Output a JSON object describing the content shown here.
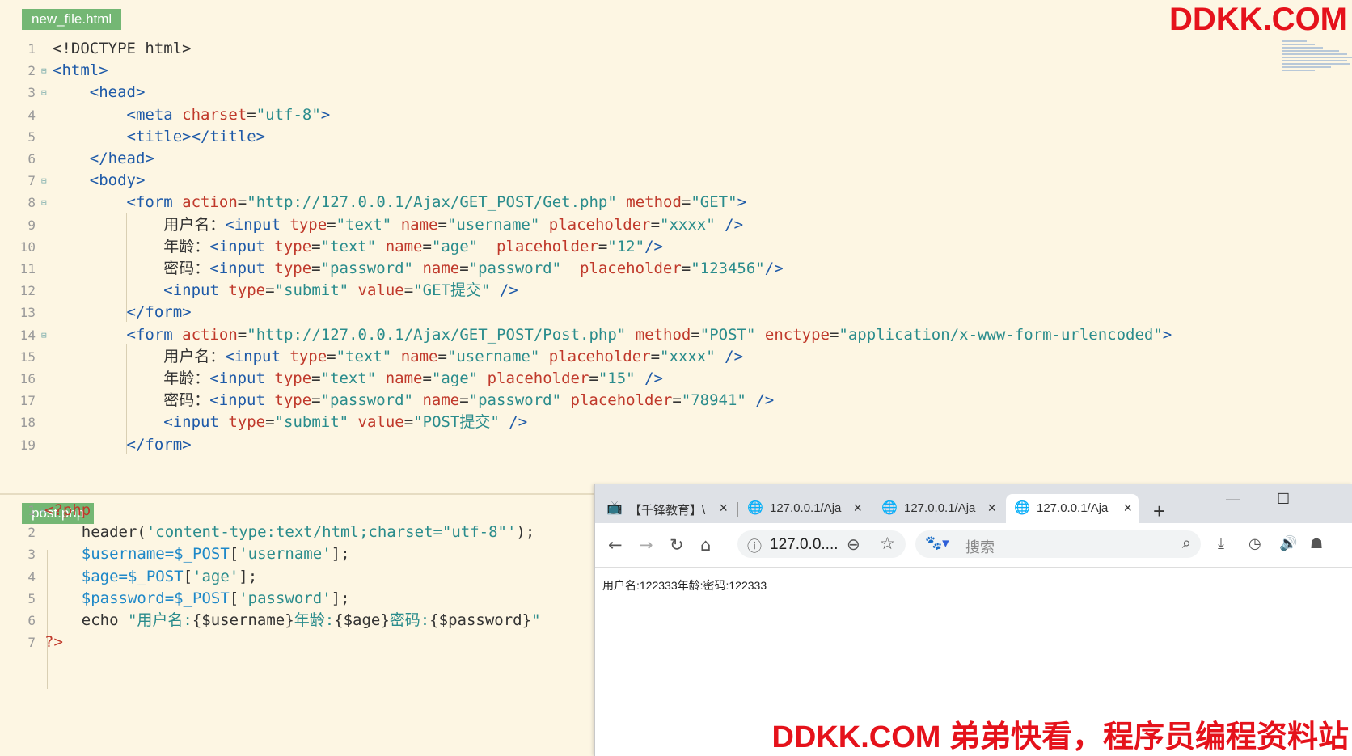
{
  "editor": {
    "top_tab": "new_file.html",
    "bottom_tab": "post.php",
    "html_lines": [
      {
        "n": "1",
        "fold": "",
        "segs": [
          [
            "t",
            "<!DOCTYPE html>"
          ]
        ]
      },
      {
        "n": "2",
        "fold": "⊟",
        "segs": [
          [
            "tag",
            "<html>"
          ]
        ]
      },
      {
        "n": "3",
        "fold": "⊟",
        "segs": [
          [
            "t",
            "    "
          ],
          [
            "tag",
            "<head>"
          ]
        ]
      },
      {
        "n": "4",
        "fold": "",
        "segs": [
          [
            "t",
            "        "
          ],
          [
            "tag",
            "<meta "
          ],
          [
            "attr",
            "charset"
          ],
          [
            "t",
            "="
          ],
          [
            "val",
            "\"utf-8\""
          ],
          [
            "tag",
            ">"
          ]
        ]
      },
      {
        "n": "5",
        "fold": "",
        "segs": [
          [
            "t",
            "        "
          ],
          [
            "tag",
            "<title></title>"
          ]
        ]
      },
      {
        "n": "6",
        "fold": "",
        "segs": [
          [
            "t",
            "    "
          ],
          [
            "tag",
            "</head>"
          ]
        ]
      },
      {
        "n": "7",
        "fold": "⊟",
        "segs": [
          [
            "t",
            "    "
          ],
          [
            "tag",
            "<body>"
          ]
        ]
      },
      {
        "n": "8",
        "fold": "⊟",
        "segs": [
          [
            "t",
            "        "
          ],
          [
            "tag",
            "<form "
          ],
          [
            "attr",
            "action"
          ],
          [
            "t",
            "="
          ],
          [
            "val",
            "\"http://127.0.0.1/Ajax/GET_POST/Get.php\""
          ],
          [
            "t",
            " "
          ],
          [
            "attr",
            "method"
          ],
          [
            "t",
            "="
          ],
          [
            "val",
            "\"GET\""
          ],
          [
            "tag",
            ">"
          ]
        ]
      },
      {
        "n": "9",
        "fold": "",
        "segs": [
          [
            "t",
            "            "
          ],
          [
            "cn",
            "用户名："
          ],
          [
            "tag",
            "<input "
          ],
          [
            "attr",
            "type"
          ],
          [
            "t",
            "="
          ],
          [
            "val",
            "\"text\""
          ],
          [
            "t",
            " "
          ],
          [
            "attr",
            "name"
          ],
          [
            "t",
            "="
          ],
          [
            "val",
            "\"username\""
          ],
          [
            "t",
            " "
          ],
          [
            "attr",
            "placeholder"
          ],
          [
            "t",
            "="
          ],
          [
            "val",
            "\"xxxx\""
          ],
          [
            "t",
            " "
          ],
          [
            "tag",
            "/>"
          ]
        ]
      },
      {
        "n": "10",
        "fold": "",
        "segs": [
          [
            "t",
            "            "
          ],
          [
            "cn",
            "年龄："
          ],
          [
            "tag",
            "<input "
          ],
          [
            "attr",
            "type"
          ],
          [
            "t",
            "="
          ],
          [
            "val",
            "\"text\""
          ],
          [
            "t",
            " "
          ],
          [
            "attr",
            "name"
          ],
          [
            "t",
            "="
          ],
          [
            "val",
            "\"age\""
          ],
          [
            "t",
            "  "
          ],
          [
            "attr",
            "placeholder"
          ],
          [
            "t",
            "="
          ],
          [
            "val",
            "\"12\""
          ],
          [
            "tag",
            "/>"
          ]
        ]
      },
      {
        "n": "11",
        "fold": "",
        "segs": [
          [
            "t",
            "            "
          ],
          [
            "cn",
            "密码："
          ],
          [
            "tag",
            "<input "
          ],
          [
            "attr",
            "type"
          ],
          [
            "t",
            "="
          ],
          [
            "val",
            "\"password\""
          ],
          [
            "t",
            " "
          ],
          [
            "attr",
            "name"
          ],
          [
            "t",
            "="
          ],
          [
            "val",
            "\"password\""
          ],
          [
            "t",
            "  "
          ],
          [
            "attr",
            "placeholder"
          ],
          [
            "t",
            "="
          ],
          [
            "val",
            "\"123456\""
          ],
          [
            "tag",
            "/>"
          ]
        ]
      },
      {
        "n": "12",
        "fold": "",
        "segs": [
          [
            "t",
            "            "
          ],
          [
            "tag",
            "<input "
          ],
          [
            "attr",
            "type"
          ],
          [
            "t",
            "="
          ],
          [
            "val",
            "\"submit\""
          ],
          [
            "t",
            " "
          ],
          [
            "attr",
            "value"
          ],
          [
            "t",
            "="
          ],
          [
            "val",
            "\"GET提交\""
          ],
          [
            "t",
            " "
          ],
          [
            "tag",
            "/>"
          ]
        ]
      },
      {
        "n": "13",
        "fold": "",
        "segs": [
          [
            "t",
            "        "
          ],
          [
            "tag",
            "</form>"
          ]
        ]
      },
      {
        "n": "14",
        "fold": "⊟",
        "segs": [
          [
            "t",
            "        "
          ],
          [
            "tag",
            "<form "
          ],
          [
            "attr",
            "action"
          ],
          [
            "t",
            "="
          ],
          [
            "val",
            "\"http://127.0.0.1/Ajax/GET_POST/Post.php\""
          ],
          [
            "t",
            " "
          ],
          [
            "attr",
            "method"
          ],
          [
            "t",
            "="
          ],
          [
            "val",
            "\"POST\""
          ],
          [
            "t",
            " "
          ],
          [
            "attr",
            "enctype"
          ],
          [
            "t",
            "="
          ],
          [
            "val",
            "\"application/x-www-form-urlencoded\""
          ],
          [
            "tag",
            ">"
          ]
        ]
      },
      {
        "n": "15",
        "fold": "",
        "segs": [
          [
            "t",
            "            "
          ],
          [
            "cn",
            "用户名："
          ],
          [
            "tag",
            "<input "
          ],
          [
            "attr",
            "type"
          ],
          [
            "t",
            "="
          ],
          [
            "val",
            "\"text\""
          ],
          [
            "t",
            " "
          ],
          [
            "attr",
            "name"
          ],
          [
            "t",
            "="
          ],
          [
            "val",
            "\"username\""
          ],
          [
            "t",
            " "
          ],
          [
            "attr",
            "placeholder"
          ],
          [
            "t",
            "="
          ],
          [
            "val",
            "\"xxxx\""
          ],
          [
            "t",
            " "
          ],
          [
            "tag",
            "/>"
          ]
        ]
      },
      {
        "n": "16",
        "fold": "",
        "segs": [
          [
            "t",
            "            "
          ],
          [
            "cn",
            "年龄："
          ],
          [
            "tag",
            "<input "
          ],
          [
            "attr",
            "type"
          ],
          [
            "t",
            "="
          ],
          [
            "val",
            "\"text\""
          ],
          [
            "t",
            " "
          ],
          [
            "attr",
            "name"
          ],
          [
            "t",
            "="
          ],
          [
            "val",
            "\"age\""
          ],
          [
            "t",
            " "
          ],
          [
            "attr",
            "placeholder"
          ],
          [
            "t",
            "="
          ],
          [
            "val",
            "\"15\""
          ],
          [
            "t",
            " "
          ],
          [
            "tag",
            "/>"
          ]
        ]
      },
      {
        "n": "17",
        "fold": "",
        "segs": [
          [
            "t",
            "            "
          ],
          [
            "cn",
            "密码："
          ],
          [
            "tag",
            "<input "
          ],
          [
            "attr",
            "type"
          ],
          [
            "t",
            "="
          ],
          [
            "val",
            "\"password\""
          ],
          [
            "t",
            " "
          ],
          [
            "attr",
            "name"
          ],
          [
            "t",
            "="
          ],
          [
            "val",
            "\"password\""
          ],
          [
            "t",
            " "
          ],
          [
            "attr",
            "placeholder"
          ],
          [
            "t",
            "="
          ],
          [
            "val",
            "\"78941\""
          ],
          [
            "t",
            " "
          ],
          [
            "tag",
            "/>"
          ]
        ]
      },
      {
        "n": "18",
        "fold": "",
        "segs": [
          [
            "t",
            "            "
          ],
          [
            "tag",
            "<input "
          ],
          [
            "attr",
            "type"
          ],
          [
            "t",
            "="
          ],
          [
            "val",
            "\"submit\""
          ],
          [
            "t",
            " "
          ],
          [
            "attr",
            "value"
          ],
          [
            "t",
            "="
          ],
          [
            "val",
            "\"POST提交\""
          ],
          [
            "t",
            " "
          ],
          [
            "tag",
            "/>"
          ]
        ]
      },
      {
        "n": "19",
        "fold": "",
        "segs": [
          [
            "t",
            "        "
          ],
          [
            "tag",
            "</form>"
          ]
        ]
      }
    ],
    "php_lines": [
      {
        "n": "1",
        "fold": "⊟",
        "segs": [
          [
            "php-kw",
            "<?php"
          ]
        ]
      },
      {
        "n": "2",
        "fold": "",
        "segs": [
          [
            "t",
            "    header("
          ],
          [
            "php-str",
            "'content-type:text/html;charset=\"utf-8\"'"
          ],
          [
            "t",
            ");"
          ]
        ]
      },
      {
        "n": "3",
        "fold": "",
        "segs": [
          [
            "php-var",
            "    $username=$_POST"
          ],
          [
            "t",
            "["
          ],
          [
            "php-str",
            "'username'"
          ],
          [
            "t",
            "];"
          ]
        ]
      },
      {
        "n": "4",
        "fold": "",
        "segs": [
          [
            "php-var",
            "    $age=$_POST"
          ],
          [
            "t",
            "["
          ],
          [
            "php-str",
            "'age'"
          ],
          [
            "t",
            "];"
          ]
        ]
      },
      {
        "n": "5",
        "fold": "",
        "segs": [
          [
            "php-var",
            "    $password=$_POST"
          ],
          [
            "t",
            "["
          ],
          [
            "php-str",
            "'password'"
          ],
          [
            "t",
            "];"
          ]
        ]
      },
      {
        "n": "6",
        "fold": "",
        "segs": [
          [
            "t",
            "    echo "
          ],
          [
            "php-str",
            "\"用户名:"
          ],
          [
            "t",
            "{$username}"
          ],
          [
            "php-str",
            "年龄:"
          ],
          [
            "t",
            "{$age}"
          ],
          [
            "php-str",
            "密码:"
          ],
          [
            "t",
            "{$password}"
          ],
          [
            "php-str",
            "\""
          ]
        ]
      },
      {
        "n": "7",
        "fold": "",
        "segs": [
          [
            "php-kw",
            "?>"
          ]
        ]
      }
    ]
  },
  "browser": {
    "tabs": [
      {
        "label": "【千锋教育】\\",
        "icon": "bilibili-icon",
        "active": false
      },
      {
        "label": "127.0.0.1/Aja",
        "icon": "globe-icon",
        "active": false
      },
      {
        "label": "127.0.0.1/Aja",
        "icon": "globe-icon",
        "active": false
      },
      {
        "label": "127.0.0.1/Aja",
        "icon": "globe-icon",
        "active": true
      }
    ],
    "new_tab": "+",
    "minimize": "—",
    "maximize": "☐",
    "address": "127.0.0....",
    "search_placeholder": "搜索",
    "page_output": "用户名:122333年龄:密码:122333"
  },
  "watermark": {
    "top": "DDKK.COM",
    "bottom": "DDKK.COM 弟弟快看，程序员编程资料站"
  },
  "colors": {
    "editor_bg": "#fdf6e3",
    "tab_green": "#74b774",
    "watermark_red": "#e5121b"
  }
}
